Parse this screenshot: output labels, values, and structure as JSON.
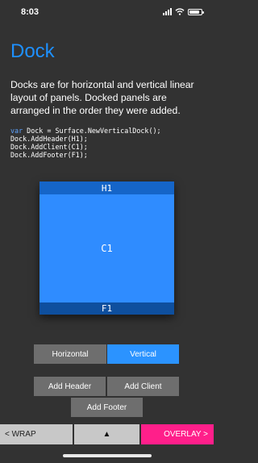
{
  "status_bar": {
    "time": "8:03",
    "signal_icon": "cellular-signal-icon",
    "wifi_icon": "wifi-icon",
    "battery_icon": "battery-icon"
  },
  "page": {
    "title": "Dock",
    "description": "Docks are for horizontal and vertical linear layout of panels. Docked panels are arranged in the order they were added.",
    "code": {
      "line1_keyword": "var",
      "line1_rest": " Dock = Surface.NewVerticalDock();",
      "line2": "Dock.AddHeader(H1);",
      "line3": "Dock.AddClient(C1);",
      "line4": "Dock.AddFooter(F1);"
    }
  },
  "dock_preview": {
    "header": "H1",
    "client": "C1",
    "footer": "F1"
  },
  "orientation": {
    "horizontal_label": "Horizontal",
    "vertical_label": "Vertical",
    "selected": "Vertical"
  },
  "actions": {
    "add_header_label": "Add Header",
    "add_client_label": "Add Client",
    "add_footer_label": "Add Footer"
  },
  "bottom_bar": {
    "wrap_label": "< WRAP",
    "up_label": "▲",
    "overlay_label": "OVERLAY >"
  },
  "colors": {
    "background": "#323232",
    "accent_blue": "#2b93ff",
    "title_blue": "#1e90ff",
    "overlay_pink": "#ff1f8a",
    "button_gray": "#6e6e6e"
  }
}
